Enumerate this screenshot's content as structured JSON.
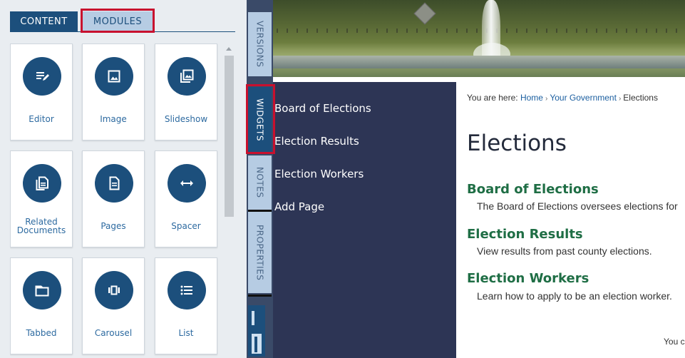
{
  "panel": {
    "tabs": {
      "content": "CONTENT",
      "modules": "MODULES"
    },
    "tiles": [
      {
        "label": "Editor",
        "icon": "editor-icon"
      },
      {
        "label": "Image",
        "icon": "image-icon"
      },
      {
        "label": "Slideshow",
        "icon": "slideshow-icon"
      },
      {
        "label": "Related Documents",
        "icon": "related-documents-icon"
      },
      {
        "label": "Pages",
        "icon": "pages-icon"
      },
      {
        "label": "Spacer",
        "icon": "spacer-icon"
      },
      {
        "label": "Tabbed",
        "icon": "tabbed-icon"
      },
      {
        "label": "Carousel",
        "icon": "carousel-icon"
      },
      {
        "label": "List",
        "icon": "list-icon"
      }
    ]
  },
  "side_tabs": {
    "versions": "VERSIONS",
    "widgets": "WIDGETS",
    "notes": "NOTES",
    "properties": "PROPERTIES"
  },
  "nav": {
    "items": [
      "Board of Elections",
      "Election Results",
      "Election Workers",
      "Add Page"
    ]
  },
  "content": {
    "breadcrumb": {
      "prefix": "You are here:",
      "home": "Home",
      "gov": "Your Government",
      "current": "Elections"
    },
    "title": "Elections",
    "sections": [
      {
        "heading": "Board of Elections",
        "desc": "The Board of Elections oversees elections for"
      },
      {
        "heading": "Election Results",
        "desc": "View results from past county elections."
      },
      {
        "heading": "Election Workers",
        "desc": "Learn how to apply to be an election worker."
      }
    ],
    "footer_snippet": "You c"
  },
  "colors": {
    "primary": "#1c4f7c",
    "tab_inactive": "#b6cce3",
    "nav_bg": "#2d3555",
    "heading_green": "#1f6e45",
    "highlight_red": "#c8102e"
  }
}
